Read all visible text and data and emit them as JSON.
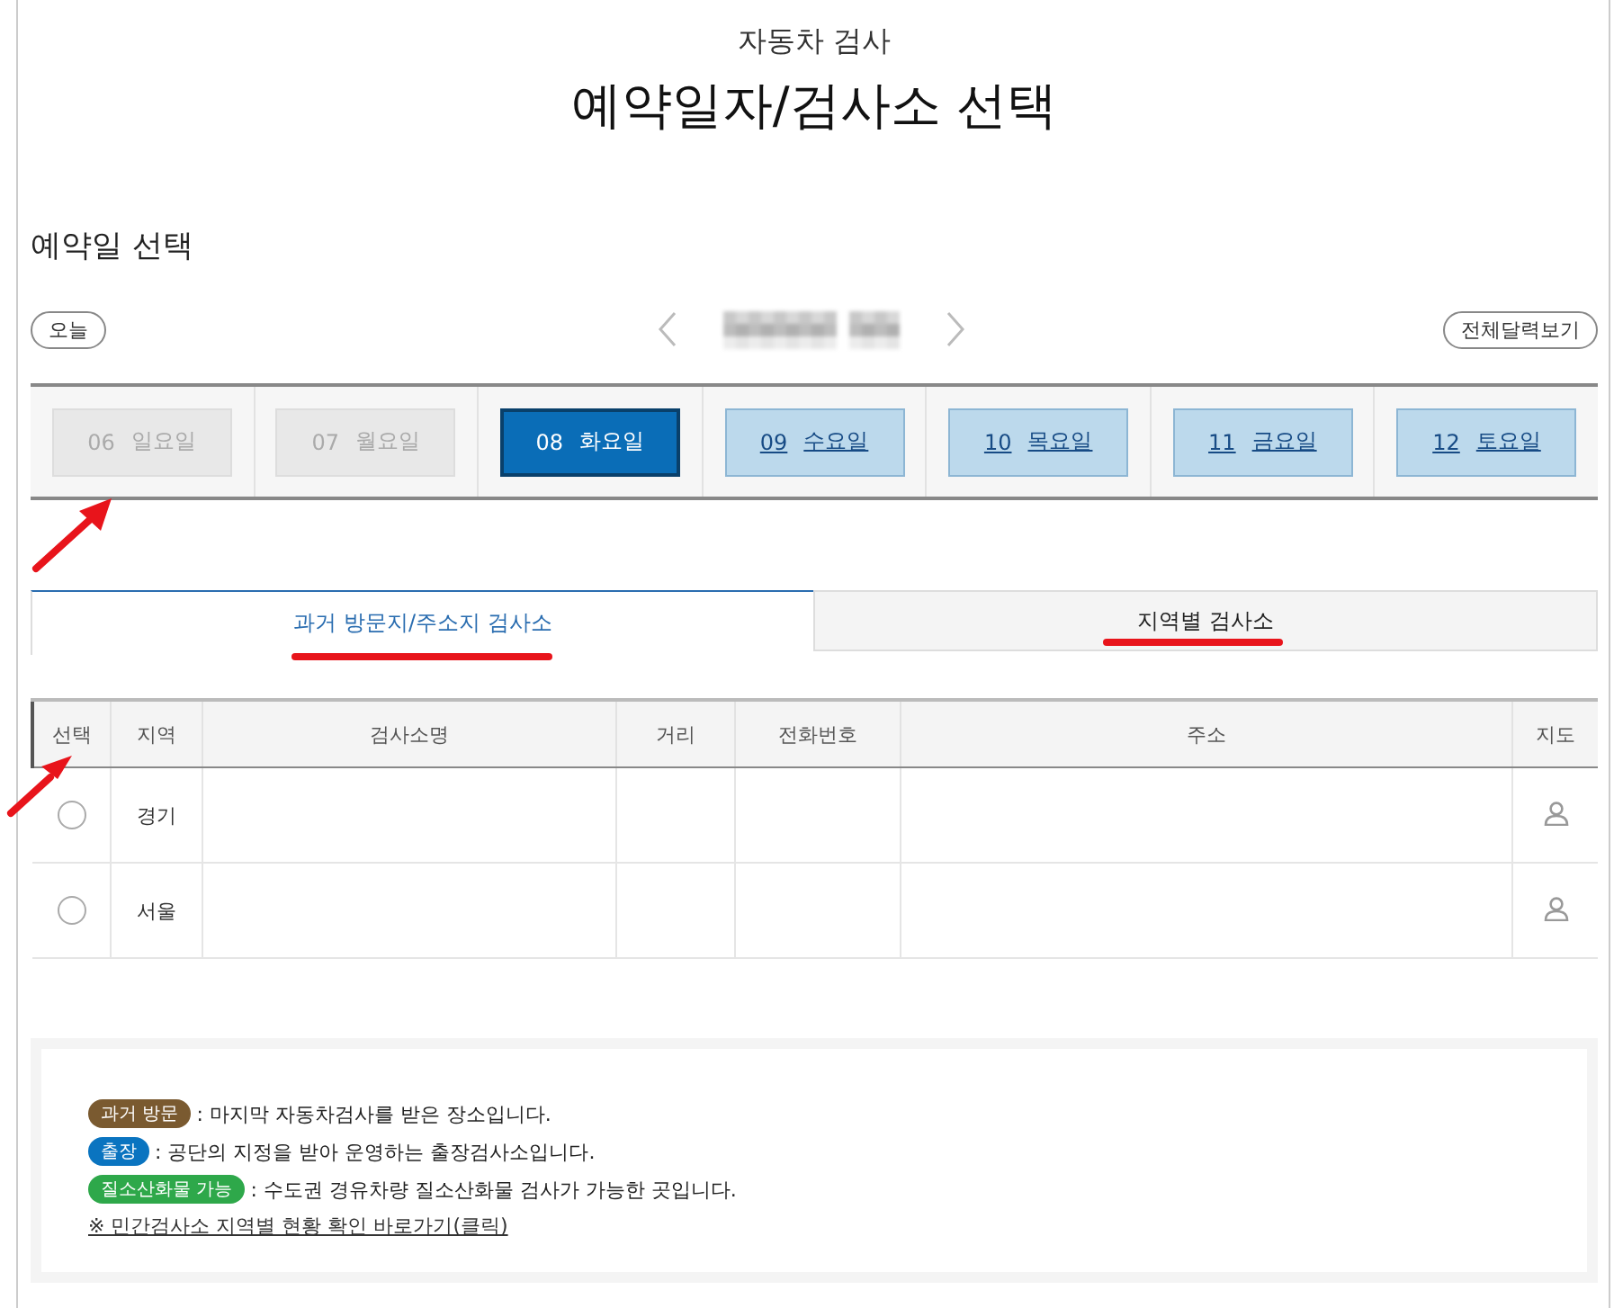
{
  "header": {
    "subtitle": "자동차 검사",
    "title": "예약일자/검사소 선택"
  },
  "date_section": {
    "heading": "예약일 선택",
    "today_button": "오늘",
    "calendar_button": "전체달력보기"
  },
  "days": [
    {
      "date": "06",
      "weekday": "일요일",
      "disabled": true,
      "selected": false
    },
    {
      "date": "07",
      "weekday": "월요일",
      "disabled": true,
      "selected": false
    },
    {
      "date": "08",
      "weekday": "화요일",
      "disabled": false,
      "selected": true
    },
    {
      "date": "09",
      "weekday": "수요일",
      "disabled": false,
      "selected": false
    },
    {
      "date": "10",
      "weekday": "목요일",
      "disabled": false,
      "selected": false
    },
    {
      "date": "11",
      "weekday": "금요일",
      "disabled": false,
      "selected": false
    },
    {
      "date": "12",
      "weekday": "토요일",
      "disabled": false,
      "selected": false
    }
  ],
  "tabs": [
    {
      "label": "과거 방문지/주소지 검사소",
      "selected": true
    },
    {
      "label": "지역별 검사소",
      "selected": false
    }
  ],
  "table": {
    "columns": [
      "선택",
      "지역",
      "검사소명",
      "거리",
      "전화번호",
      "주소",
      "지도"
    ],
    "rows": [
      {
        "selected": false,
        "region": "경기"
      },
      {
        "selected": false,
        "region": "서울"
      }
    ]
  },
  "legend": {
    "items": [
      {
        "badge": "과거 방문",
        "color": "#7a5a30",
        "text": ": 마지막 자동차검사를 받은 장소입니다."
      },
      {
        "badge": "출장",
        "color": "#0a74c0",
        "text": ": 공단의 지정을 받아 운영하는 출장검사소입니다."
      },
      {
        "badge": "질소산화물 가능",
        "color": "#2ea84a",
        "text": ": 수도권 경유차량 질소산화물 검사가 가능한 곳입니다."
      }
    ],
    "link": "※ 민간검사소 지역별 현황 확인 바로가기(클릭)"
  }
}
